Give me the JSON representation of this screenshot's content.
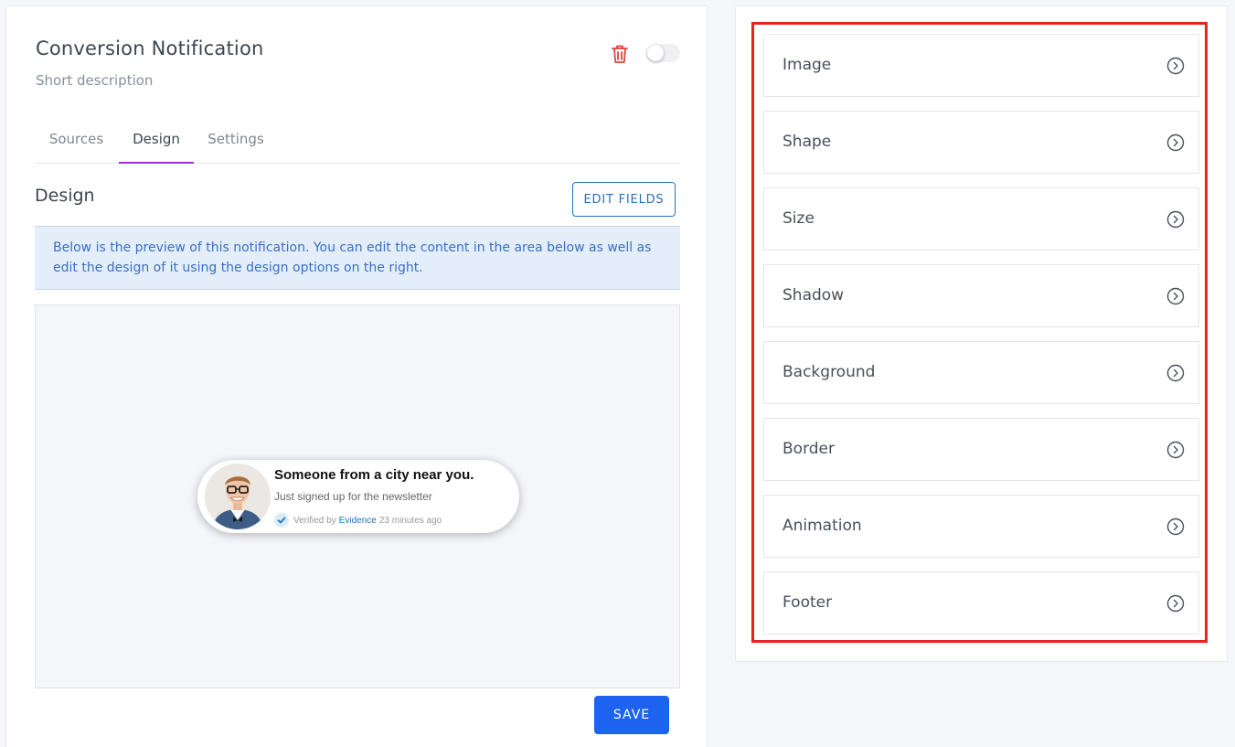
{
  "header": {
    "title": "Conversion Notification",
    "subtitle": "Short description",
    "enabled": false
  },
  "tabs": [
    {
      "label": "Sources",
      "active": false
    },
    {
      "label": "Design",
      "active": true
    },
    {
      "label": "Settings",
      "active": false
    }
  ],
  "design": {
    "title": "Design",
    "edit_fields_label": "EDIT FIELDS",
    "info_text": "Below is the preview of this notification. You can edit the content in the area below as well as edit the design of it using the design options on the right."
  },
  "notification": {
    "title": "Someone from a city near you.",
    "message": "Just signed up for the newsletter",
    "verified_prefix": "Verified by",
    "verified_brand": "Evidence",
    "time": "23 minutes ago"
  },
  "save_label": "SAVE",
  "options": [
    "Image",
    "Shape",
    "Size",
    "Shadow",
    "Background",
    "Border",
    "Animation",
    "Footer"
  ],
  "colors": {
    "accent": "#9b30d9",
    "primary": "#1d63f0",
    "highlight": "#e8231f",
    "delete": "#e0443e",
    "info_bg": "#e4eefb"
  },
  "icons": {
    "delete": "trash-icon",
    "option": "chevron-right-circle-icon",
    "verified": "check-icon"
  }
}
